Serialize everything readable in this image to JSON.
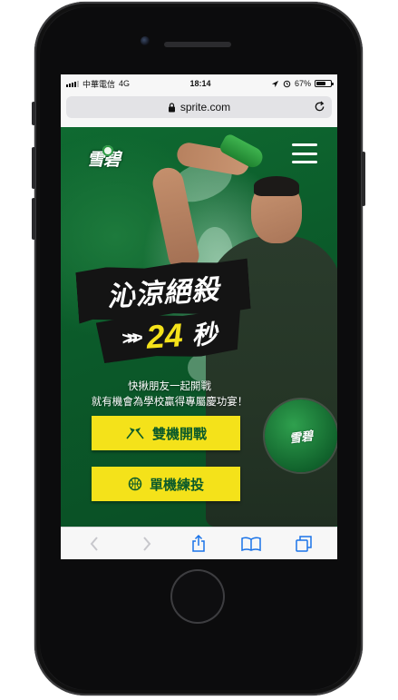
{
  "status_bar": {
    "carrier": "中華電信",
    "network": "4G",
    "time": "18:14",
    "battery_percent": "67%",
    "battery_level": 0.67
  },
  "browser": {
    "url": "sprite.com"
  },
  "page": {
    "logo_text": "雪碧",
    "headline": "沁涼絕殺",
    "countdown_chevrons": ">>>",
    "countdown_number": "24",
    "countdown_unit": "秒",
    "tagline_line1": "快揪朋友一起開戰",
    "tagline_line2": "就有機會為學校贏得專屬慶功宴！",
    "ball_logo_text": "雪碧",
    "cta_multiplayer": "雙機開戰",
    "cta_single": "單機練投"
  },
  "colors": {
    "brand_green": "#0b5a2a",
    "accent_yellow": "#f4e21a"
  },
  "icons": {
    "menu": "hamburger-menu-icon",
    "lock": "lock-icon",
    "reload": "reload-icon",
    "multi": "crossed-flags-icon",
    "single": "basketball-icon",
    "back": "chevron-left-icon",
    "forward": "chevron-right-icon",
    "share": "share-icon",
    "bookmarks": "book-icon",
    "tabs": "tabs-icon"
  }
}
